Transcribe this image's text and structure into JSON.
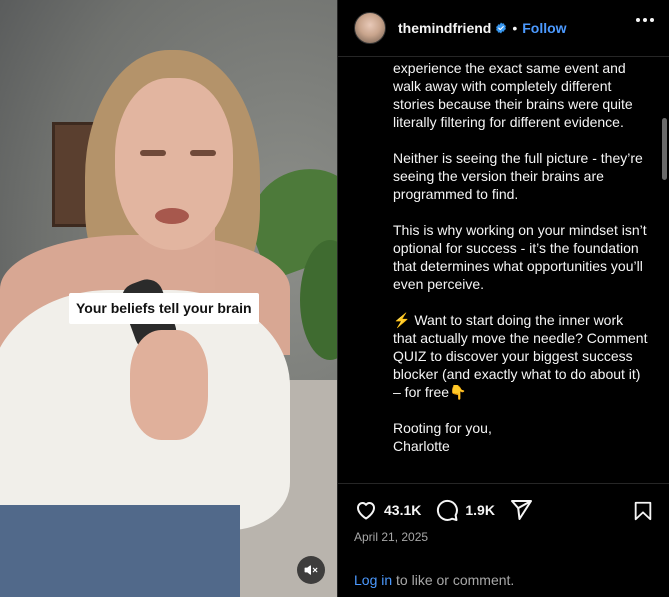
{
  "video": {
    "caption_text": "Your beliefs tell your brain"
  },
  "header": {
    "username": "themindfriend",
    "separator": "•",
    "follow_label": "Follow"
  },
  "post": {
    "paragraphs": [
      "experience the exact same event and walk away with completely different stories because their brains were quite literally filtering for different evidence.",
      "Neither is seeing the full picture - they’re seeing the version their brains are programmed to find.",
      "This is why working on your mindset isn’t optional for success - it’s the foundation that determines what opportunities you’ll even perceive.",
      "⚡ Want to start doing the inner work that actually move the needle? Comment QUIZ to discover your biggest success blocker (and exactly what to do about it) – for free👇",
      "Rooting for you,\nCharlotte"
    ]
  },
  "actions": {
    "likes": "43.1K",
    "comments": "1.9K",
    "date": "April 21, 2025",
    "login_link": "Log in",
    "login_rest": " to like or comment."
  },
  "colors": {
    "accent": "#4c9aff",
    "background": "#000000",
    "muted_text": "#a8a8a8"
  },
  "icons": [
    "verified-badge-icon",
    "more-options-icon",
    "heart-icon",
    "comment-icon",
    "share-icon",
    "bookmark-icon",
    "muted-speaker-icon"
  ]
}
